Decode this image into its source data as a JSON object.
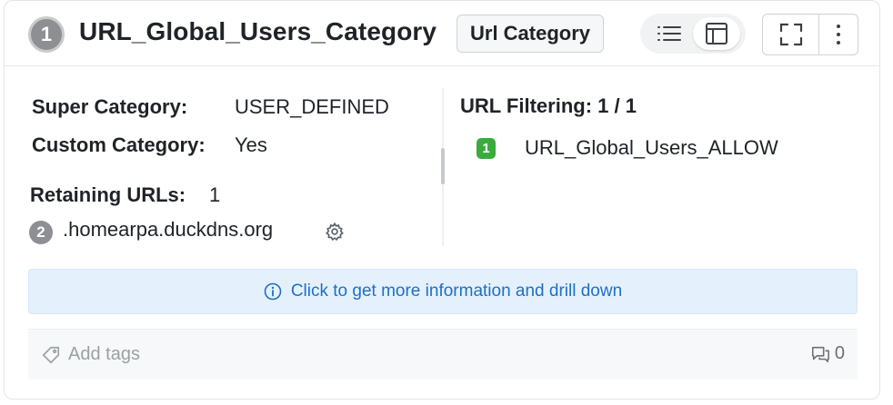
{
  "header": {
    "badge_number": "1",
    "title": "URL_Global_Users_Category",
    "type_tag": "Url Category"
  },
  "details": {
    "super_category_label": "Super Category:",
    "super_category_value": "USER_DEFINED",
    "custom_category_label": "Custom Category:",
    "custom_category_value": "Yes",
    "retaining_urls_label": "Retaining URLs:",
    "retaining_urls_count": "1",
    "urls": [
      {
        "badge": "2",
        "value": ".homearpa.duckdns.org"
      }
    ]
  },
  "url_filtering": {
    "label": "URL Filtering: 1 / 1",
    "rules": [
      {
        "badge": "1",
        "name": "URL_Global_Users_ALLOW",
        "color": "#3aac3e"
      }
    ]
  },
  "info_banner": {
    "text": "Click to get more information and drill down",
    "icon": "info-icon"
  },
  "footer": {
    "tags_placeholder": "Add tags",
    "comment_count": "0"
  },
  "colors": {
    "accent": "#1f6fc7",
    "banner_bg": "#e4f1fc",
    "badge_gray": "#8d8f92",
    "rule_green": "#3aac3e"
  }
}
